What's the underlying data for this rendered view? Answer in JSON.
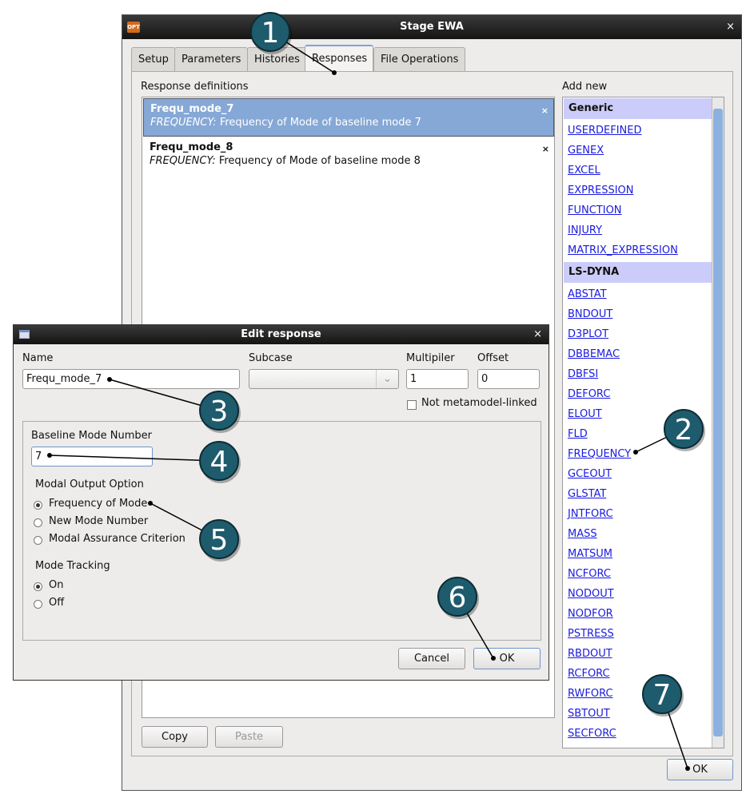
{
  "main_window": {
    "title": "Stage EWA",
    "app_icon": "OPT",
    "close": "×",
    "tabs": [
      {
        "label": "Setup"
      },
      {
        "label": "Parameters"
      },
      {
        "label": "Histories"
      },
      {
        "label": "Responses",
        "active": true
      },
      {
        "label": "File Operations"
      }
    ],
    "response_definitions_label": "Response definitions",
    "responses": [
      {
        "name": "Frequ_mode_7",
        "type": "FREQUENCY:",
        "desc": "Frequency of Mode of baseline mode 7",
        "selected": true
      },
      {
        "name": "Frequ_mode_8",
        "type": "FREQUENCY:",
        "desc": "Frequency of Mode of baseline mode 8"
      }
    ],
    "delete_glyph": "×",
    "add_new_label": "Add new",
    "add_new": {
      "generic_header": "Generic",
      "generic": [
        "USERDEFINED",
        "GENEX",
        "EXCEL",
        "EXPRESSION",
        "FUNCTION",
        "INJURY",
        "MATRIX_EXPRESSION"
      ],
      "lsdyna_header": "LS-DYNA",
      "lsdyna": [
        "ABSTAT",
        "BNDOUT",
        "D3PLOT",
        "DBBEMAC",
        "DBFSI",
        "DEFORC",
        "ELOUT",
        "FLD",
        "FREQUENCY",
        "GCEOUT",
        "GLSTAT",
        "JNTFORC",
        "MASS",
        "MATSUM",
        "NCFORC",
        "NODOUT",
        "NODFOR",
        "PSTRESS",
        "RBDOUT",
        "RCFORC",
        "RWFORC",
        "SBTOUT",
        "SECFORC"
      ]
    },
    "copy": "Copy",
    "paste": "Paste",
    "ok": "OK"
  },
  "edit_dialog": {
    "title": "Edit response",
    "close": "×",
    "name_label": "Name",
    "name_value": "Frequ_mode_7",
    "subcase_label": "Subcase",
    "subcase_value": "",
    "multiplier_label": "Multipiler",
    "multiplier_value": "1",
    "offset_label": "Offset",
    "offset_value": "0",
    "not_linked": "Not metamodel-linked",
    "baseline_label": "Baseline Mode Number",
    "baseline_value": "7",
    "modal_label": "Modal Output Option",
    "modal_options": [
      "Frequency of Mode",
      "New Mode Number",
      "Modal Assurance Criterion"
    ],
    "modal_selected": 0,
    "tracking_label": "Mode Tracking",
    "tracking_options": [
      "On",
      "Off"
    ],
    "tracking_selected": 0,
    "cancel": "Cancel",
    "ok": "OK"
  },
  "callouts": [
    "1",
    "2",
    "3",
    "4",
    "5",
    "6",
    "7"
  ],
  "callout_color": "#1e5b6d"
}
